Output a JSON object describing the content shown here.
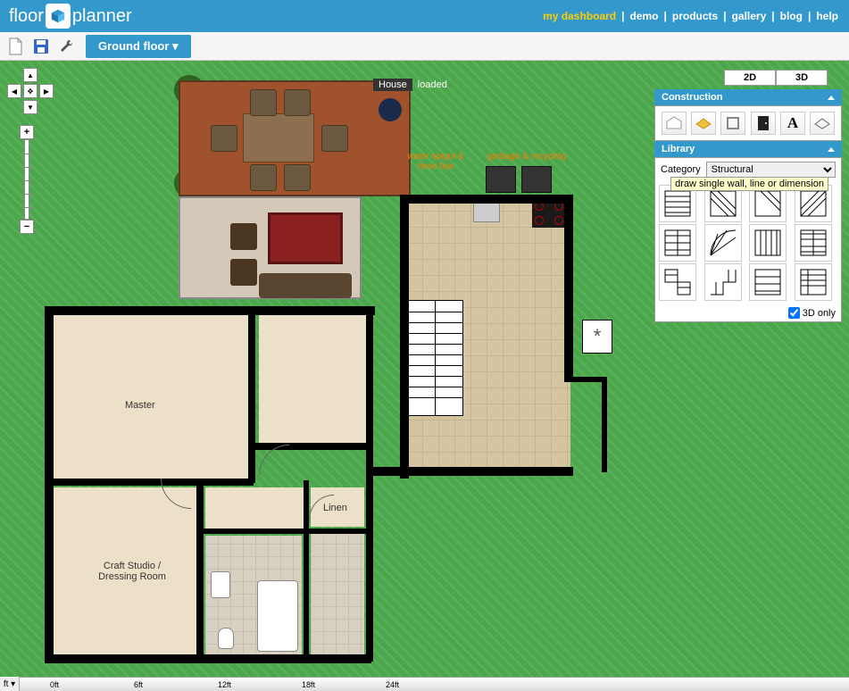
{
  "header": {
    "logo_left": "floor",
    "logo_right": "planner",
    "nav": [
      "my dashboard",
      "demo",
      "products",
      "gallery",
      "blog",
      "help"
    ],
    "nav_active_index": 0
  },
  "toolbar": {
    "floor_label": "Ground floor ▾"
  },
  "canvas": {
    "title": "House",
    "status": "loaded",
    "view_2d": "2D",
    "view_3d": "3D",
    "ruler_unit": "ft ▾",
    "ruler_marks": [
      "0ft",
      "6ft",
      "12ft",
      "18ft",
      "24ft"
    ]
  },
  "annotations": {
    "spigot": "water spigot & hose box",
    "garbage": "garbage & recycling"
  },
  "rooms": {
    "master": "Master",
    "craft": "Craft Studio / Dressing Room",
    "linen": "Linen"
  },
  "panels": {
    "construction": {
      "title": "Construction",
      "tooltip": "draw single wall, line or dimension"
    },
    "library": {
      "title": "Library",
      "category_label": "Category",
      "category_value": "Structural",
      "checkbox_label": "3D only"
    }
  },
  "icons": {
    "star": "*"
  }
}
